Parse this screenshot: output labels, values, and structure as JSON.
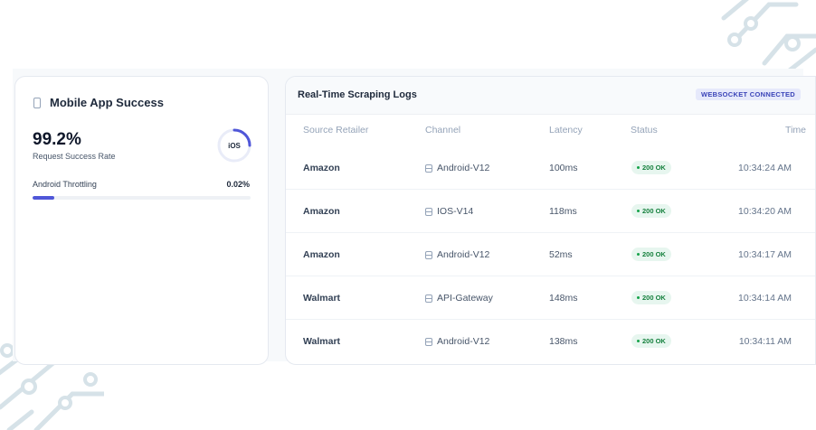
{
  "colors": {
    "accent": "#4f56d8",
    "status_ok_bg": "#e7f6ef",
    "status_ok_text": "#15803d",
    "badge_bg": "#e6e9fb",
    "badge_text": "#3b44b8"
  },
  "mobile_card": {
    "icon": "phone-icon",
    "title": "Mobile App Success",
    "success_rate": "99.2%",
    "success_label": "Request Success Rate",
    "ring_label": "iOS",
    "ring_progress": 0.25,
    "throttle_label": "Android Throttling",
    "throttle_value": "0.02%",
    "throttle_bar_fraction": 0.1
  },
  "logs": {
    "title": "Real-Time Scraping Logs",
    "badge": "WEBSOCKET CONNECTED",
    "columns": {
      "retailer": "Source Retailer",
      "channel": "Channel",
      "latency": "Latency",
      "status": "Status",
      "time": "Time"
    },
    "channel_icon": "database-icon",
    "rows": [
      {
        "retailer": "Amazon",
        "channel": "Android-V12",
        "latency": "100ms",
        "status": "200 OK",
        "time": "10:34:24 AM"
      },
      {
        "retailer": "Amazon",
        "channel": "IOS-V14",
        "latency": "118ms",
        "status": "200 OK",
        "time": "10:34:20 AM"
      },
      {
        "retailer": "Amazon",
        "channel": "Android-V12",
        "latency": "52ms",
        "status": "200 OK",
        "time": "10:34:17 AM"
      },
      {
        "retailer": "Walmart",
        "channel": "API-Gateway",
        "latency": "148ms",
        "status": "200 OK",
        "time": "10:34:14 AM"
      },
      {
        "retailer": "Walmart",
        "channel": "Android-V12",
        "latency": "138ms",
        "status": "200 OK",
        "time": "10:34:11 AM"
      }
    ]
  }
}
